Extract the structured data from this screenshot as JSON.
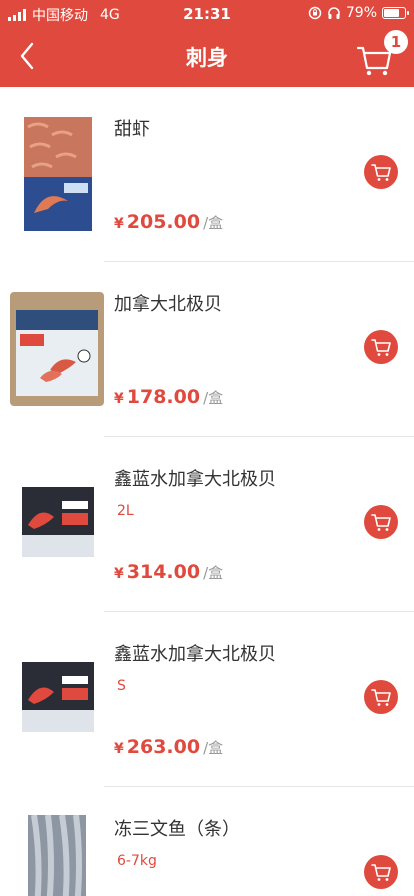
{
  "status_bar": {
    "carrier": "中国移动",
    "network": "4G",
    "time": "21:31",
    "battery": "79%",
    "battery_level": 0.79
  },
  "header": {
    "title": "刺身",
    "cart_count": "1"
  },
  "colors": {
    "accent": "#e0493d",
    "price": "#e0493d",
    "unit": "#9a9a9a"
  },
  "products": [
    {
      "name": "甜虾",
      "spec": "",
      "currency": "¥",
      "price": "205.00",
      "unit": "/盒"
    },
    {
      "name": "加拿大北极贝",
      "spec": "",
      "currency": "¥",
      "price": "178.00",
      "unit": "/盒"
    },
    {
      "name": "鑫蓝水加拿大北极贝",
      "spec": "2L",
      "currency": "¥",
      "price": "314.00",
      "unit": "/盒"
    },
    {
      "name": "鑫蓝水加拿大北极贝",
      "spec": "S",
      "currency": "¥",
      "price": "263.00",
      "unit": "/盒"
    },
    {
      "name": "冻三文鱼（条）",
      "spec": "6-7kg",
      "currency": "",
      "price": "",
      "unit": ""
    }
  ]
}
